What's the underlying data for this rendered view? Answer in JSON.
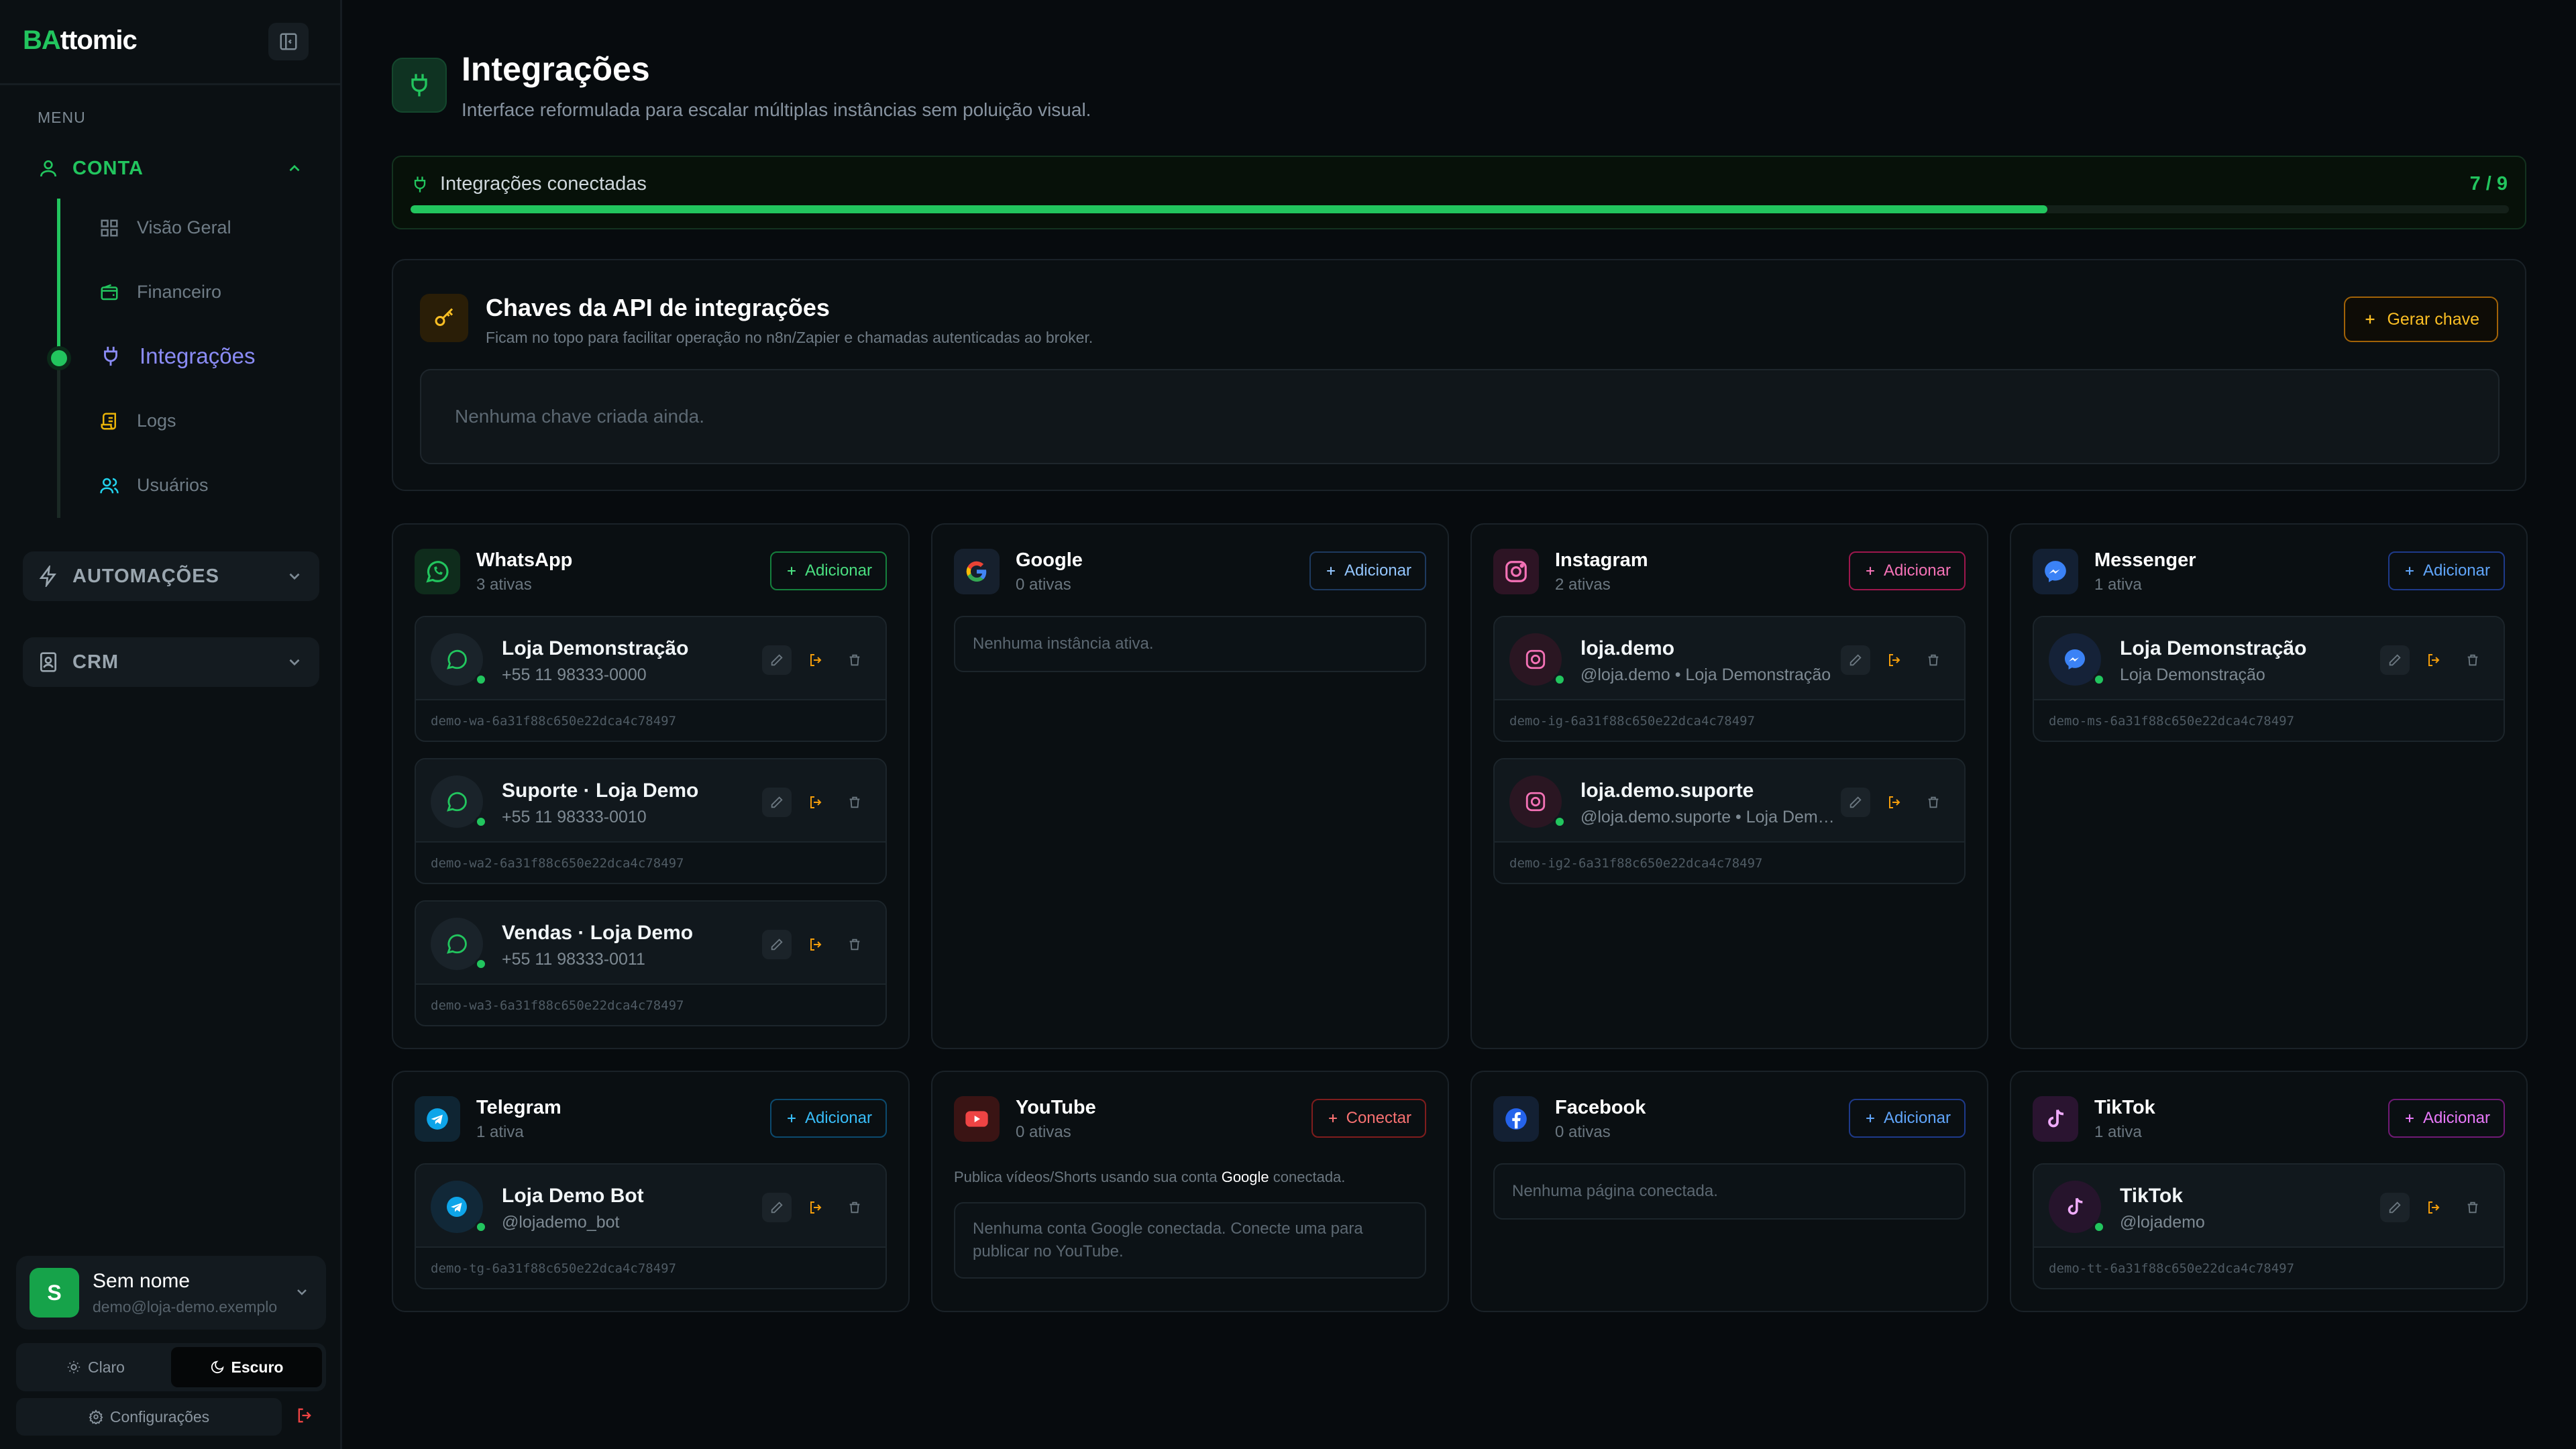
{
  "brand": {
    "accent": "BA",
    "rest": "ttomic"
  },
  "sidebar": {
    "menu_label": "MENU",
    "groups": {
      "conta": "CONTA",
      "automacoes": "AUTOMAÇÕES",
      "crm": "CRM"
    },
    "items": [
      {
        "label": "Visão Geral"
      },
      {
        "label": "Financeiro"
      },
      {
        "label": "Integrações",
        "active": true
      },
      {
        "label": "Logs"
      },
      {
        "label": "Usuários"
      }
    ],
    "user": {
      "initial": "S",
      "name": "Sem nome",
      "email": "demo@loja-demo.exemplo"
    },
    "theme": {
      "light": "Claro",
      "dark": "Escuro",
      "selected": "dark"
    },
    "settings": "Configurações"
  },
  "page": {
    "title": "Integrações",
    "subtitle": "Interface reformulada para escalar múltiplas instâncias sem poluição visual."
  },
  "progress": {
    "label": "Integrações conectadas",
    "count_text": "7 / 9",
    "fraction": 0.78
  },
  "api": {
    "title": "Chaves da API de integrações",
    "subtitle": "Ficam no topo para facilitar operação no n8n/Zapier e chamadas autenticadas ao broker.",
    "button": "Gerar chave",
    "empty": "Nenhuma chave criada ainda."
  },
  "providers": {
    "whatsapp": {
      "name": "WhatsApp",
      "count": "3 ativas",
      "button": "Adicionar",
      "color": "#22c55e",
      "instances": [
        {
          "name": "Loja Demonstração",
          "sub": "+55 11 98333-0000",
          "id": "demo-wa-6a31f88c650e22dca4c78497"
        },
        {
          "name": "Suporte · Loja Demo",
          "sub": "+55 11 98333-0010",
          "id": "demo-wa2-6a31f88c650e22dca4c78497"
        },
        {
          "name": "Vendas · Loja Demo",
          "sub": "+55 11 98333-0011",
          "id": "demo-wa3-6a31f88c650e22dca4c78497"
        }
      ]
    },
    "google": {
      "name": "Google",
      "count": "0 ativas",
      "button": "Adicionar",
      "color": "#93c5fd",
      "empty": "Nenhuma instância ativa."
    },
    "instagram": {
      "name": "Instagram",
      "count": "2 ativas",
      "button": "Adicionar",
      "color": "#f472b6",
      "instances": [
        {
          "name": "loja.demo",
          "sub": "@loja.demo • Loja Demonstração",
          "id": "demo-ig-6a31f88c650e22dca4c78497"
        },
        {
          "name": "loja.demo.suporte",
          "sub": "@loja.demo.suporte • Loja Demo Suporte",
          "id": "demo-ig2-6a31f88c650e22dca4c78497"
        }
      ]
    },
    "messenger": {
      "name": "Messenger",
      "count": "1 ativa",
      "button": "Adicionar",
      "color": "#60a5fa",
      "instances": [
        {
          "name": "Loja Demonstração",
          "sub": "Loja Demonstração",
          "id": "demo-ms-6a31f88c650e22dca4c78497"
        }
      ]
    },
    "telegram": {
      "name": "Telegram",
      "count": "1 ativa",
      "button": "Adicionar",
      "color": "#38bdf8",
      "instances": [
        {
          "name": "Loja Demo Bot",
          "sub": "@lojademo_bot",
          "id": "demo-tg-6a31f88c650e22dca4c78497"
        }
      ]
    },
    "youtube": {
      "name": "YouTube",
      "count": "0 ativas",
      "button": "Conectar",
      "color": "#f87171",
      "note_pre": "Publica vídeos/Shorts usando sua conta ",
      "note_bold": "Google",
      "note_post": " conectada.",
      "empty": "Nenhuma conta Google conectada. Conecte uma para publicar no YouTube."
    },
    "facebook": {
      "name": "Facebook",
      "count": "0 ativas",
      "button": "Adicionar",
      "color": "#60a5fa",
      "empty": "Nenhuma página conectada."
    },
    "tiktok": {
      "name": "TikTok",
      "count": "1 ativa",
      "button": "Adicionar",
      "color": "#e879f9",
      "instances": [
        {
          "name": "TikTok",
          "sub": "@lojademo",
          "id": "demo-tt-6a31f88c650e22dca4c78497"
        }
      ]
    }
  }
}
